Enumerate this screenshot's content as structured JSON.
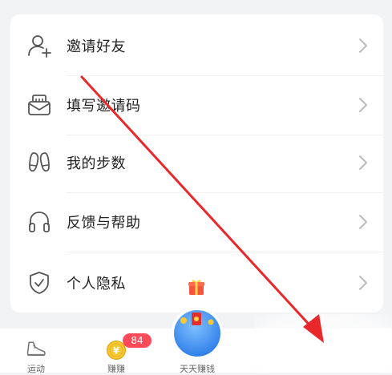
{
  "menu": {
    "items": [
      {
        "label": "邀请好友",
        "icon": "add-user-icon"
      },
      {
        "label": "填写邀请码",
        "icon": "envelope-icon"
      },
      {
        "label": "我的步数",
        "icon": "footprints-icon"
      },
      {
        "label": "反馈与帮助",
        "icon": "headphones-icon"
      },
      {
        "label": "个人隐私",
        "icon": "shield-check-icon"
      }
    ]
  },
  "tabbar": {
    "tabs": [
      {
        "label": "运动",
        "icon": "sneaker-icon"
      },
      {
        "label": "赚赚",
        "icon": "coin-icon",
        "badge": "84"
      },
      {
        "label": "天天赚钱",
        "icon": "money-globe-icon"
      }
    ]
  },
  "colors": {
    "accent_blue": "#3d8cf0",
    "badge_red": "#ff4a5a",
    "annotation_red": "#e8282b",
    "icon_gray": "#555555"
  }
}
